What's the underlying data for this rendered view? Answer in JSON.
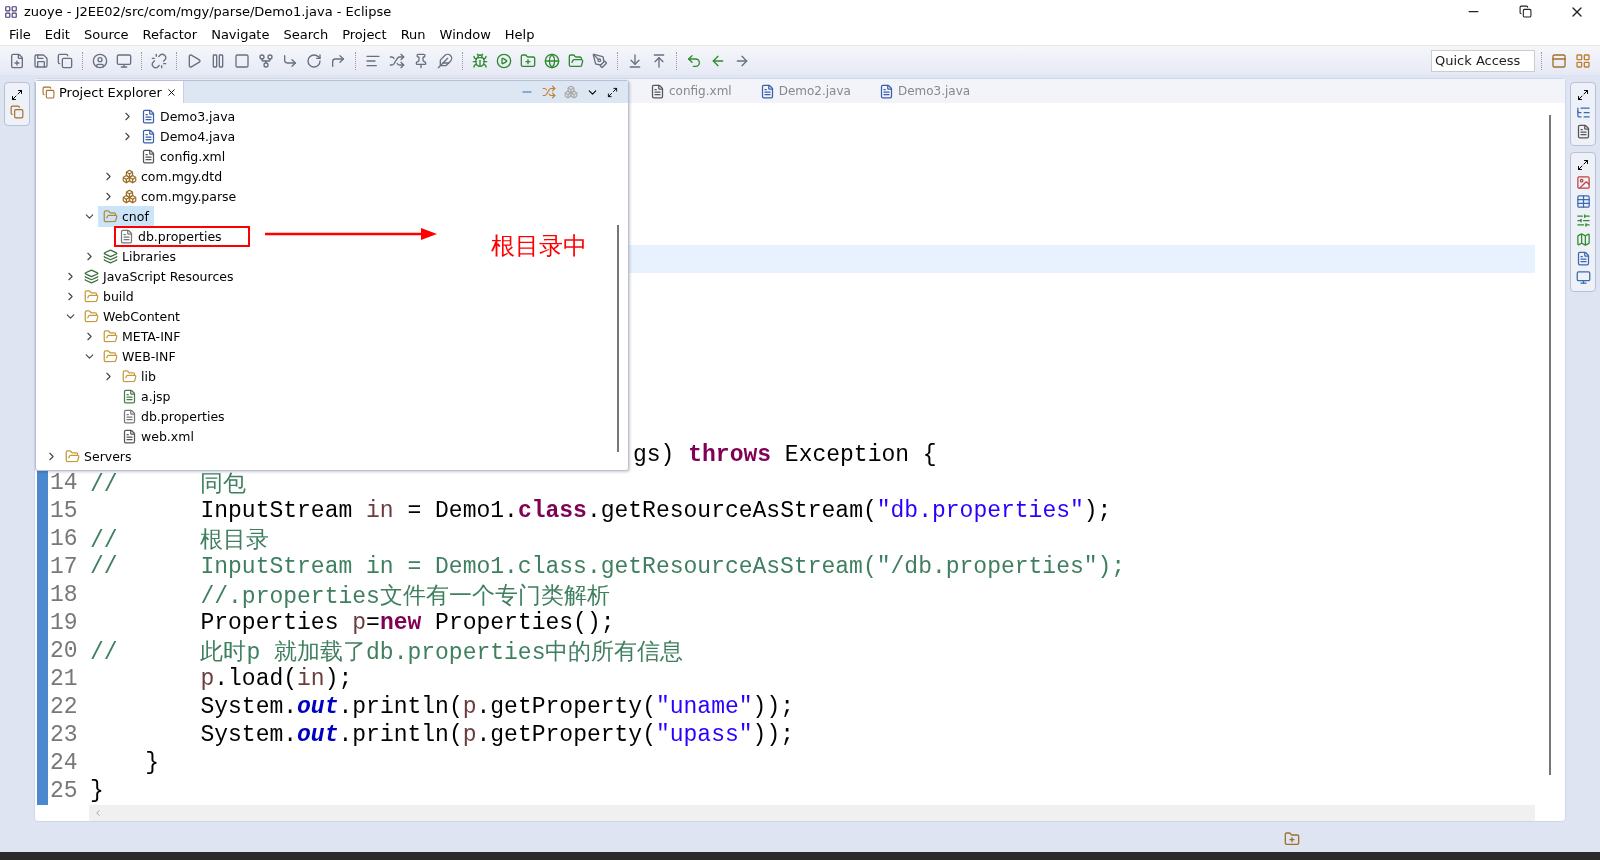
{
  "window": {
    "title": "zuoye - J2EE02/src/com/mgy/parse/Demo1.java - Eclipse"
  },
  "menu": [
    "File",
    "Edit",
    "Source",
    "Refactor",
    "Navigate",
    "Search",
    "Project",
    "Run",
    "Window",
    "Help"
  ],
  "quick_access": {
    "placeholder": "Quick Access"
  },
  "explorer": {
    "title": "Project Explorer",
    "tree": [
      {
        "children": [
          {
            "children": [
              {
                "children": [
                  {
                    "children": [
                      {
                        "label": "Demo3.java",
                        "kind": "java",
                        "expanded": false,
                        "selected": false
                      },
                      {
                        "label": "Demo4.java",
                        "kind": "java",
                        "expanded": false,
                        "selected": false
                      },
                      {
                        "label": "config.xml",
                        "kind": "xml",
                        "selected": false
                      }
                    ]
                  },
                  {
                    "label": "com.mgy.dtd",
                    "kind": "package",
                    "expanded": false,
                    "selected": false
                  },
                  {
                    "label": "com.mgy.parse",
                    "kind": "package",
                    "expanded": false,
                    "selected": false
                  }
                ]
              },
              {
                "label": "cnof",
                "kind": "source",
                "expanded": true,
                "selected": true,
                "children": [
                  {
                    "label": "db.properties",
                    "kind": "file",
                    "selected": false,
                    "boxed": true
                  }
                ]
              },
              {
                "label": "Libraries",
                "kind": "library",
                "expanded": false,
                "selected": false
              }
            ]
          },
          {
            "label": "JavaScript Resources",
            "kind": "library",
            "expanded": false,
            "selected": false
          },
          {
            "label": "build",
            "kind": "folder",
            "expanded": false,
            "selected": false
          },
          {
            "label": "WebContent",
            "kind": "folder",
            "expanded": true,
            "selected": false,
            "children": [
              {
                "label": "META-INF",
                "kind": "folder",
                "expanded": false,
                "selected": false
              },
              {
                "label": "WEB-INF",
                "kind": "folder",
                "expanded": true,
                "selected": false,
                "children": [
                  {
                    "label": "lib",
                    "kind": "folder",
                    "expanded": false,
                    "selected": false
                  },
                  {
                    "label": "a.jsp",
                    "kind": "jsp",
                    "selected": false
                  },
                  {
                    "label": "db.properties",
                    "kind": "file",
                    "selected": false
                  },
                  {
                    "label": "web.xml",
                    "kind": "xml",
                    "selected": false
                  }
                ]
              }
            ]
          }
        ]
      },
      {
        "label": "Servers",
        "kind": "folder",
        "expanded": false,
        "selected": false
      }
    ],
    "annotation": {
      "text": "根目录中"
    }
  },
  "editor": {
    "tabs": [
      {
        "label": "config.xml",
        "kind": "xml",
        "selected": false
      },
      {
        "label": "Demo2.java",
        "kind": "java",
        "selected": false
      },
      {
        "label": "Demo3.java",
        "kind": "java",
        "selected": false
      }
    ],
    "lines": [
      {
        "kind": "partial",
        "tokens": [
          {
            "t": "gs) ",
            "kind": "plain"
          },
          {
            "t": "throws",
            "kind": "keyword"
          },
          {
            "t": " Exception {",
            "kind": "plain"
          }
        ]
      },
      {
        "kind": "full",
        "number": "14",
        "tokens": [
          {
            "t": "//      同包",
            "kind": "comment"
          }
        ]
      },
      {
        "kind": "full",
        "number": "15",
        "tokens": [
          {
            "t": "        InputStream ",
            "kind": "plain"
          },
          {
            "t": "in",
            "kind": "variable"
          },
          {
            "t": " = Demo1.",
            "kind": "plain"
          },
          {
            "t": "class",
            "kind": "keyword"
          },
          {
            "t": ".getResourceAsStream(",
            "kind": "plain"
          },
          {
            "t": "\"db.properties\"",
            "kind": "string"
          },
          {
            "t": ");",
            "kind": "plain"
          }
        ]
      },
      {
        "kind": "full",
        "number": "16",
        "tokens": [
          {
            "t": "//      根目录",
            "kind": "comment"
          }
        ]
      },
      {
        "kind": "full",
        "number": "17",
        "tokens": [
          {
            "t": "//      InputStream in = Demo1.class.getResourceAsStream(\"/db.properties\");",
            "kind": "comment"
          }
        ]
      },
      {
        "kind": "full",
        "number": "18",
        "tokens": [
          {
            "t": "        //.properties文件有一个专门类解析",
            "kind": "comment"
          }
        ]
      },
      {
        "kind": "full",
        "number": "19",
        "tokens": [
          {
            "t": "        Properties ",
            "kind": "plain"
          },
          {
            "t": "p",
            "kind": "variable"
          },
          {
            "t": "=",
            "kind": "plain"
          },
          {
            "t": "new",
            "kind": "keyword"
          },
          {
            "t": " Properties();",
            "kind": "plain"
          }
        ]
      },
      {
        "kind": "full",
        "number": "20",
        "tokens": [
          {
            "t": "//      此时p 就加载了db.properties中的所有信息",
            "kind": "comment"
          }
        ]
      },
      {
        "kind": "full",
        "number": "21",
        "tokens": [
          {
            "t": "        p",
            "kind": "variable"
          },
          {
            "t": ".load(",
            "kind": "plain"
          },
          {
            "t": "in",
            "kind": "variable"
          },
          {
            "t": ");",
            "kind": "plain"
          }
        ]
      },
      {
        "kind": "full",
        "number": "22",
        "tokens": [
          {
            "t": "        System.",
            "kind": "plain"
          },
          {
            "t": "out",
            "kind": "field"
          },
          {
            "t": ".println(",
            "kind": "plain"
          },
          {
            "t": "p",
            "kind": "variable"
          },
          {
            "t": ".getProperty(",
            "kind": "plain"
          },
          {
            "t": "\"uname\"",
            "kind": "string"
          },
          {
            "t": "));",
            "kind": "plain"
          }
        ]
      },
      {
        "kind": "full",
        "number": "23",
        "tokens": [
          {
            "t": "        System.",
            "kind": "plain"
          },
          {
            "t": "out",
            "kind": "field"
          },
          {
            "t": ".println(",
            "kind": "plain"
          },
          {
            "t": "p",
            "kind": "variable"
          },
          {
            "t": ".getProperty(",
            "kind": "plain"
          },
          {
            "t": "\"upass\"",
            "kind": "string"
          },
          {
            "t": "));",
            "kind": "plain"
          }
        ]
      },
      {
        "kind": "full",
        "number": "24",
        "tokens": [
          {
            "t": "    }",
            "kind": "plain"
          }
        ]
      },
      {
        "kind": "full",
        "number": "25",
        "tokens": [
          {
            "t": "}",
            "kind": "plain"
          }
        ]
      }
    ]
  }
}
